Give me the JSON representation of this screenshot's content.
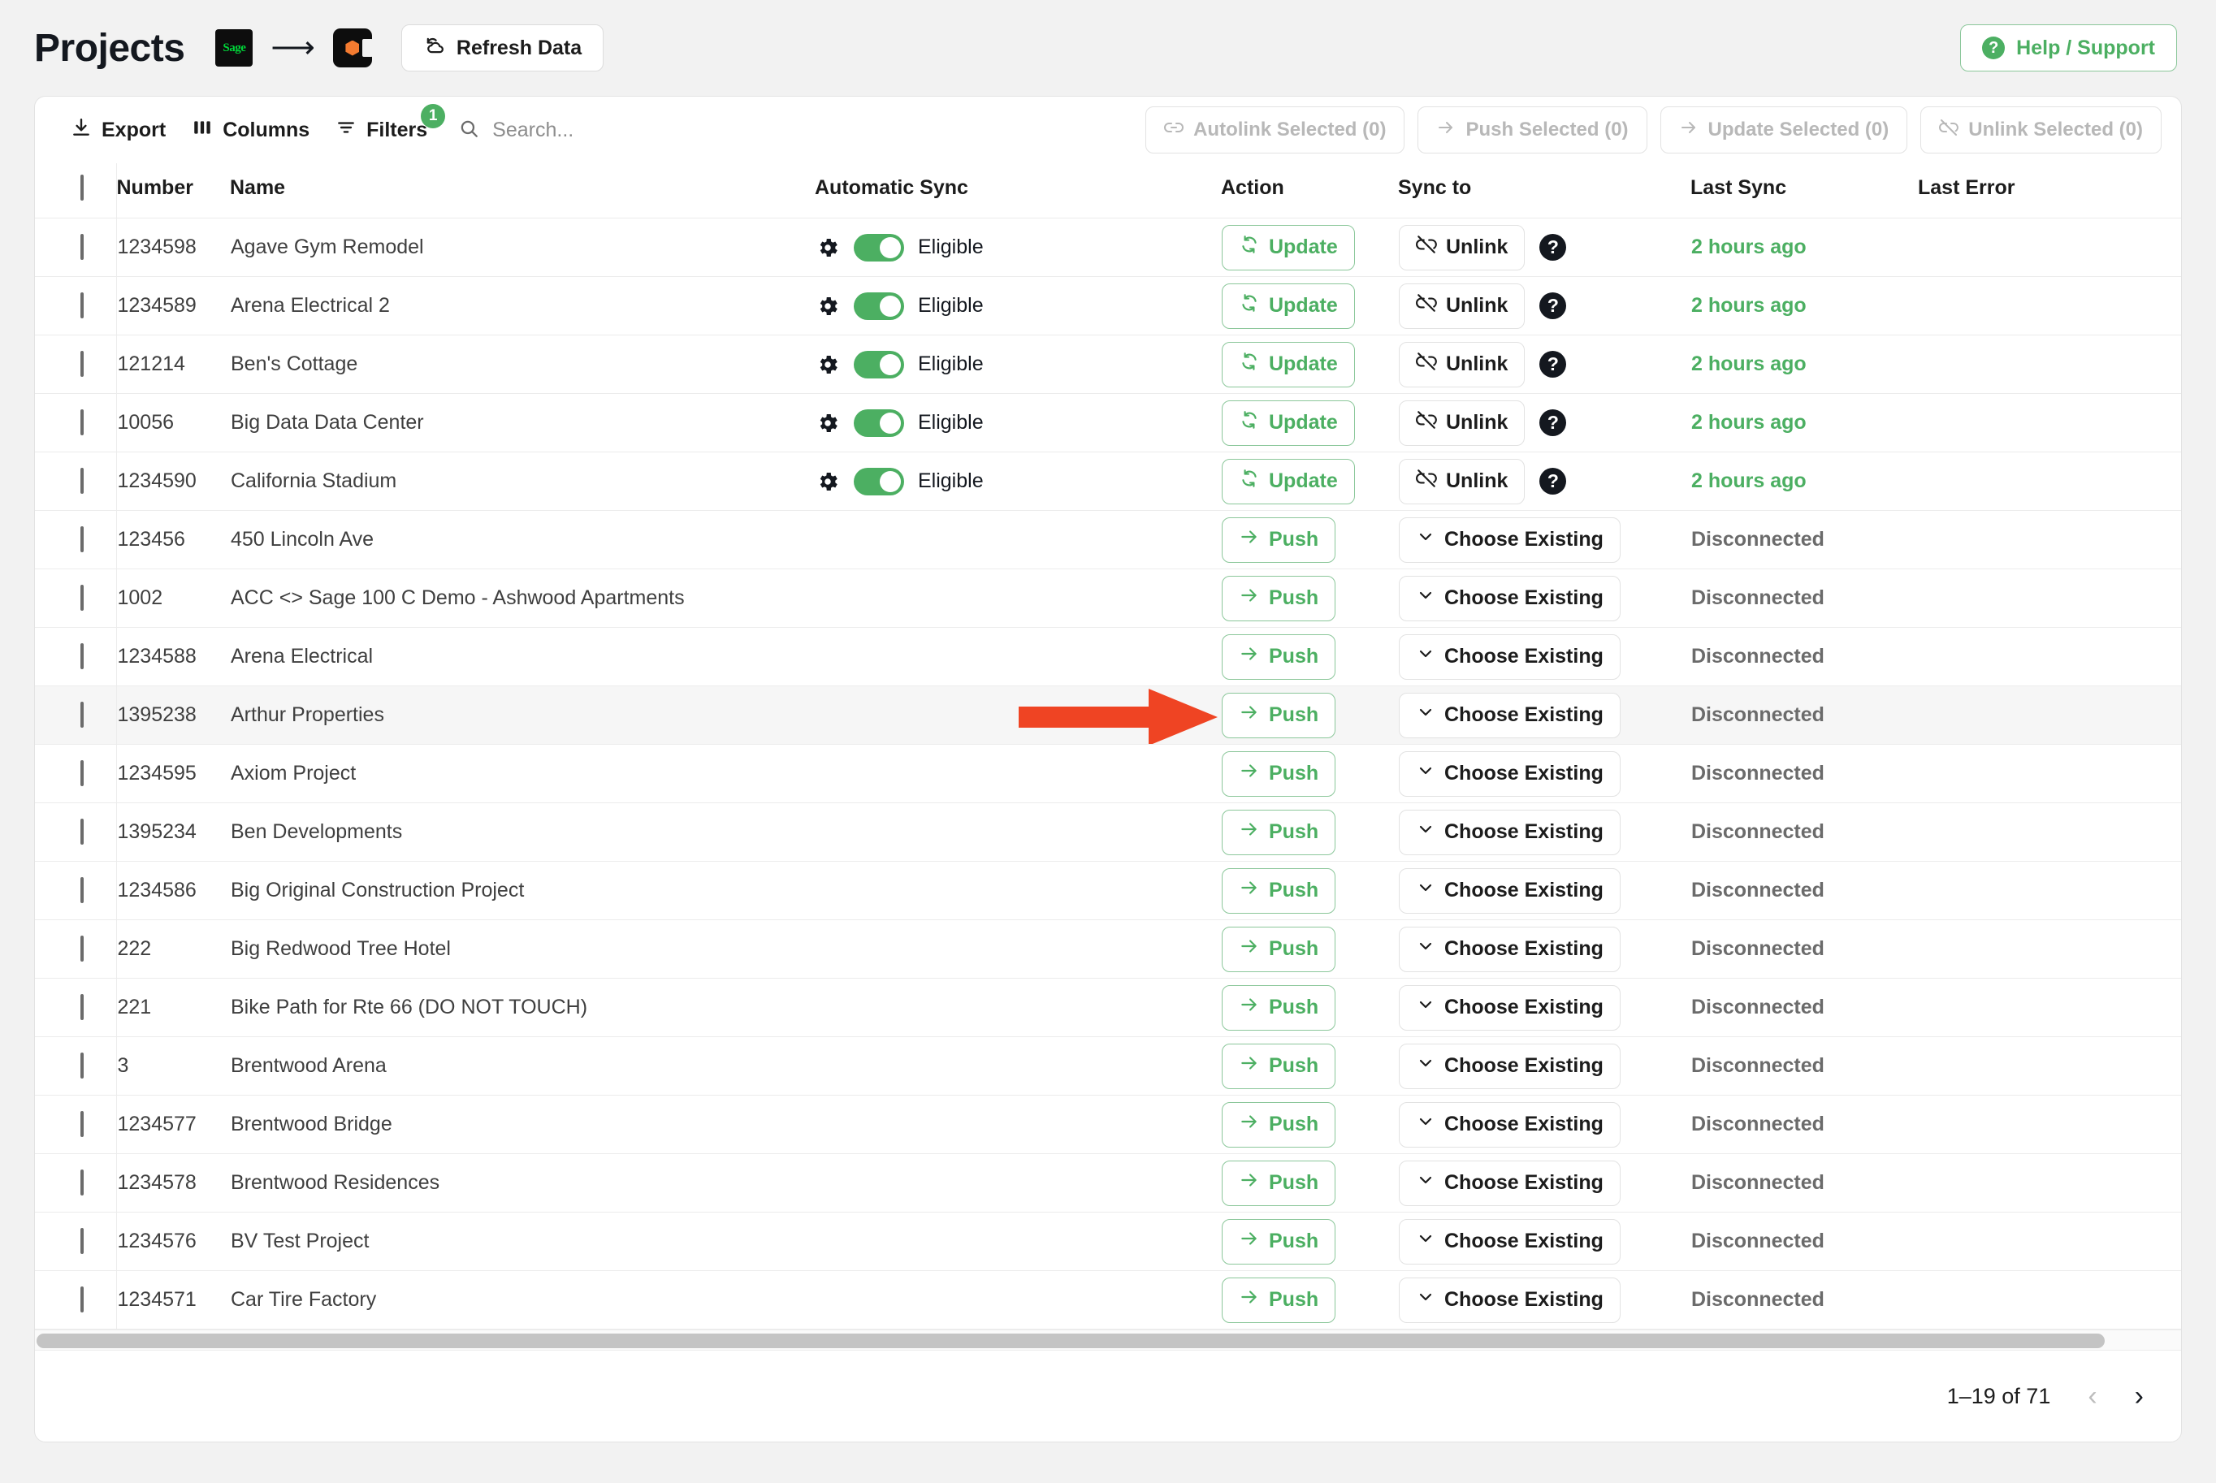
{
  "header": {
    "title": "Projects",
    "source_logo": "sage-logo",
    "arrow_icon": "arrow-right-icon",
    "target_logo": "procore-logo",
    "sage_text": "Sage",
    "refresh_label": "Refresh Data",
    "refresh_icon": "refresh-cloud-icon",
    "help_label": "Help / Support",
    "help_icon": "question-circle-icon"
  },
  "toolbar": {
    "export_label": "Export",
    "export_icon": "download-icon",
    "columns_label": "Columns",
    "columns_icon": "columns-icon",
    "filters_label": "Filters",
    "filters_icon": "filter-icon",
    "filters_badge": "1",
    "search_placeholder": "Search...",
    "search_value": "",
    "search_icon": "search-icon",
    "bulk_actions": [
      {
        "label": "Autolink Selected (0)",
        "icon": "link-icon",
        "disabled": true
      },
      {
        "label": "Push Selected (0)",
        "icon": "arrow-right-icon",
        "disabled": true
      },
      {
        "label": "Update Selected (0)",
        "icon": "arrow-right-icon",
        "disabled": true
      },
      {
        "label": "Unlink Selected (0)",
        "icon": "unlink-icon",
        "disabled": true
      }
    ]
  },
  "table": {
    "columns": [
      "Number",
      "Name",
      "Automatic Sync",
      "Action",
      "Sync to",
      "Last Sync",
      "Last Error"
    ],
    "select_all_checked": false,
    "labels": {
      "eligible": "Eligible",
      "update": "Update",
      "push": "Push",
      "unlink": "Unlink",
      "choose_existing": "Choose Existing",
      "disconnected": "Disconnected",
      "two_hours_ago": "2 hours ago"
    },
    "rows": [
      {
        "number": "1234598",
        "name": "Agave Gym Remodel",
        "sync_state": "eligible",
        "action": "Update",
        "sync_to": "Unlink",
        "last_sync": "2 hours ago",
        "last_error": "",
        "highlight": false
      },
      {
        "number": "1234589",
        "name": "Arena Electrical 2",
        "sync_state": "eligible",
        "action": "Update",
        "sync_to": "Unlink",
        "last_sync": "2 hours ago",
        "last_error": "",
        "highlight": false
      },
      {
        "number": "121214",
        "name": "Ben's Cottage",
        "sync_state": "eligible",
        "action": "Update",
        "sync_to": "Unlink",
        "last_sync": "2 hours ago",
        "last_error": "",
        "highlight": false
      },
      {
        "number": "10056",
        "name": "Big Data Data Center",
        "sync_state": "eligible",
        "action": "Update",
        "sync_to": "Unlink",
        "last_sync": "2 hours ago",
        "last_error": "",
        "highlight": false
      },
      {
        "number": "1234590",
        "name": "California Stadium",
        "sync_state": "eligible",
        "action": "Update",
        "sync_to": "Unlink",
        "last_sync": "2 hours ago",
        "last_error": "",
        "highlight": false
      },
      {
        "number": "123456",
        "name": "450 Lincoln Ave",
        "sync_state": "none",
        "action": "Push",
        "sync_to": "Choose Existing",
        "last_sync": "Disconnected",
        "last_error": "",
        "highlight": false
      },
      {
        "number": "1002",
        "name": "ACC <> Sage 100 C Demo - Ashwood Apartments",
        "sync_state": "none",
        "action": "Push",
        "sync_to": "Choose Existing",
        "last_sync": "Disconnected",
        "last_error": "",
        "highlight": false
      },
      {
        "number": "1234588",
        "name": "Arena Electrical",
        "sync_state": "none",
        "action": "Push",
        "sync_to": "Choose Existing",
        "last_sync": "Disconnected",
        "last_error": "",
        "highlight": false
      },
      {
        "number": "1395238",
        "name": "Arthur Properties",
        "sync_state": "none",
        "action": "Push",
        "sync_to": "Choose Existing",
        "last_sync": "Disconnected",
        "last_error": "",
        "highlight": true
      },
      {
        "number": "1234595",
        "name": "Axiom Project",
        "sync_state": "none",
        "action": "Push",
        "sync_to": "Choose Existing",
        "last_sync": "Disconnected",
        "last_error": "",
        "highlight": false
      },
      {
        "number": "1395234",
        "name": "Ben Developments",
        "sync_state": "none",
        "action": "Push",
        "sync_to": "Choose Existing",
        "last_sync": "Disconnected",
        "last_error": "",
        "highlight": false
      },
      {
        "number": "1234586",
        "name": "Big Original Construction Project",
        "sync_state": "none",
        "action": "Push",
        "sync_to": "Choose Existing",
        "last_sync": "Disconnected",
        "last_error": "",
        "highlight": false
      },
      {
        "number": "222",
        "name": "Big Redwood Tree Hotel",
        "sync_state": "none",
        "action": "Push",
        "sync_to": "Choose Existing",
        "last_sync": "Disconnected",
        "last_error": "",
        "highlight": false
      },
      {
        "number": "221",
        "name": "Bike Path for Rte 66 (DO NOT TOUCH)",
        "sync_state": "none",
        "action": "Push",
        "sync_to": "Choose Existing",
        "last_sync": "Disconnected",
        "last_error": "",
        "highlight": false
      },
      {
        "number": "3",
        "name": "Brentwood Arena",
        "sync_state": "none",
        "action": "Push",
        "sync_to": "Choose Existing",
        "last_sync": "Disconnected",
        "last_error": "",
        "highlight": false
      },
      {
        "number": "1234577",
        "name": "Brentwood Bridge",
        "sync_state": "none",
        "action": "Push",
        "sync_to": "Choose Existing",
        "last_sync": "Disconnected",
        "last_error": "",
        "highlight": false
      },
      {
        "number": "1234578",
        "name": "Brentwood Residences",
        "sync_state": "none",
        "action": "Push",
        "sync_to": "Choose Existing",
        "last_sync": "Disconnected",
        "last_error": "",
        "highlight": false
      },
      {
        "number": "1234576",
        "name": "BV Test Project",
        "sync_state": "none",
        "action": "Push",
        "sync_to": "Choose Existing",
        "last_sync": "Disconnected",
        "last_error": "",
        "highlight": false
      },
      {
        "number": "1234571",
        "name": "Car Tire Factory",
        "sync_state": "none",
        "action": "Push",
        "sync_to": "Choose Existing",
        "last_sync": "Disconnected",
        "last_error": "",
        "highlight": false
      }
    ]
  },
  "footer": {
    "range": "1–19 of 71",
    "prev_icon": "chevron-left-icon",
    "next_icon": "chevron-right-icon",
    "prev_disabled": true
  },
  "annotation": {
    "type": "arrow",
    "color": "#ef4423",
    "points_to": "push-button-row-9"
  },
  "colors": {
    "accent_green": "#4caf62",
    "annotation_red": "#ef4423",
    "page_bg": "#f2f2f2",
    "row_highlight": "#f6f6f6"
  }
}
